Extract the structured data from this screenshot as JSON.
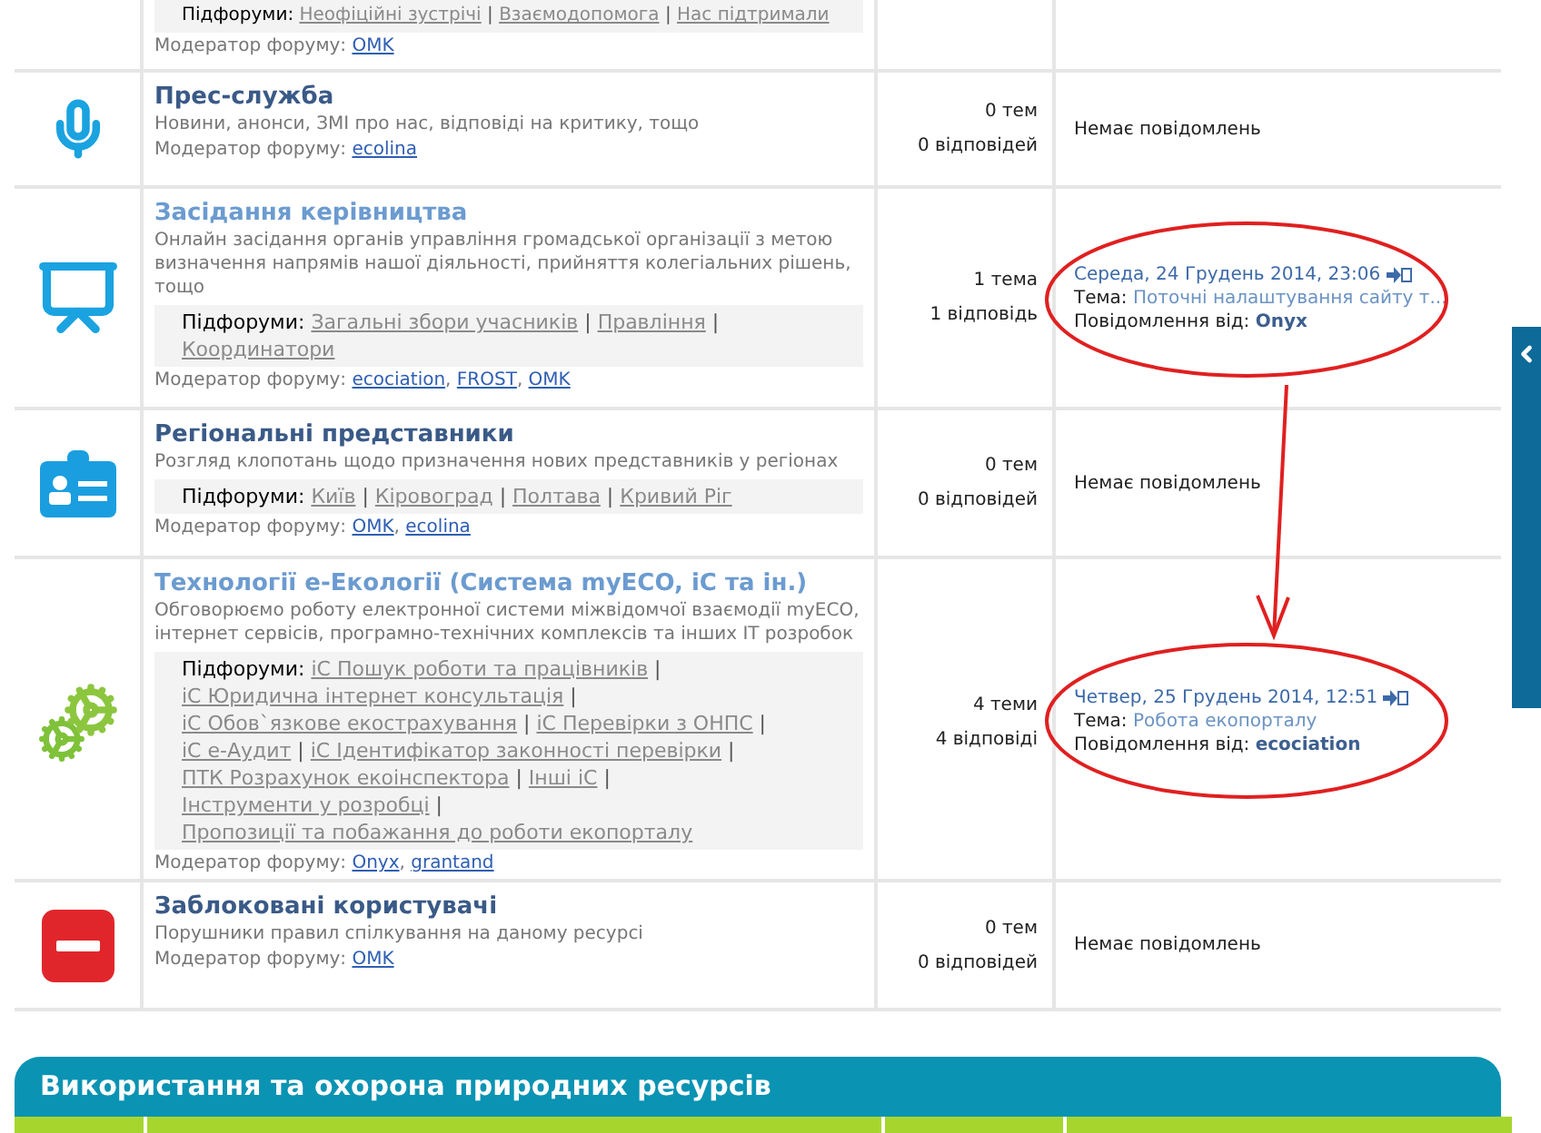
{
  "separator": "|",
  "moderator_separator": ",",
  "top_forum": {
    "subforums_label": "Підфоруми:",
    "subforums": [
      "Неофіційні зустрічі",
      "Взаємодопомога",
      "Нас підтримали"
    ],
    "moderator_label": "Модератор форуму:",
    "moderators": [
      "OMK"
    ]
  },
  "forums": [
    {
      "kind": "microphone",
      "title": "Прес-служба",
      "visited": false,
      "description": "Новини, анонси, ЗМІ про нас, відповіді на критику, тощо",
      "moderator_label": "Модератор форуму:",
      "moderators": [
        "ecolina"
      ],
      "topics": "0 тем",
      "replies": "0 відповідей",
      "last_post": {
        "kind": "empty",
        "text": "Немає повідомлень"
      }
    },
    {
      "kind": "presentation",
      "title": "Засідання керівництва",
      "visited": true,
      "description": "Онлайн засідання органів управління громадської організації з метою визначення напрямів нашої діяльності, прийняття колегіальних рішень, тощо",
      "subforums_label": "Підфоруми:",
      "subforums": [
        "Загальні збори учасників",
        "Правління",
        "Координатори"
      ],
      "moderator_label": "Модератор форуму:",
      "moderators": [
        "ecociation",
        "FROST",
        "OMK"
      ],
      "topics": "1 тема",
      "replies": "1 відповідь",
      "last_post": {
        "kind": "post",
        "date": "Середа, 24 Грудень 2014, 23:06",
        "topic_label": "Тема:",
        "topic": "Поточні налаштування сайту т...",
        "by_label": "Повідомлення від:",
        "author": "Onyx"
      }
    },
    {
      "kind": "badge",
      "title": "Регіональні представники",
      "visited": false,
      "description": "Розгляд клопотань щодо призначення нових представників у регіонах",
      "subforums_label": "Підфоруми:",
      "subforums": [
        "Київ",
        "Кіровоград",
        "Полтава",
        "Кривий Ріг"
      ],
      "moderator_label": "Модератор форуму:",
      "moderators": [
        "OMK",
        "ecolina"
      ],
      "topics": "0 тем",
      "replies": "0 відповідей",
      "last_post": {
        "kind": "empty",
        "text": "Немає повідомлень"
      }
    },
    {
      "kind": "gears",
      "title": "Технології e-Екології (Система myECO, iC та ін.)",
      "visited": true,
      "description": "Обговорюємо роботу електронної системи міжвідомчої взаємодії myECO, інтернет сервісів, програмно-технічних комплексів та інших IT розробок",
      "subforums_label": "Підфоруми:",
      "subforums": [
        "iC Пошук роботи та працівників",
        "iC Юридична інтернет консультація",
        "iC Обов`язкове екострахування",
        "iC Перевірки з ОНПС",
        "iC e-Аудит",
        "iC Ідентифікатор законності перевірки",
        "ПТК Розрахунок екоінспектора",
        "Інші iC",
        "Інструменти у розробці",
        "Пропозиції та побажання до роботи екопорталу"
      ],
      "moderator_label": "Модератор форуму:",
      "moderators": [
        "Onyx",
        "grantand"
      ],
      "topics": "4 теми",
      "replies": "4 відповіді",
      "last_post": {
        "kind": "post",
        "date": "Четвер, 25 Грудень 2014, 12:51",
        "topic_label": "Тема:",
        "topic": "Робота екопорталу",
        "by_label": "Повідомлення від:",
        "author": "ecociation"
      }
    },
    {
      "kind": "blocked",
      "title": "Заблоковані користувачі",
      "visited": false,
      "description": "Порушники правил спілкування на даному ресурсі",
      "moderator_label": "Модератор форуму:",
      "moderators": [
        "OMK"
      ],
      "topics": "0 тем",
      "replies": "0 відповідей",
      "last_post": {
        "kind": "empty",
        "text": "Немає повідомлень"
      }
    }
  ],
  "next_section": {
    "title": "Використання та охорона природних ресурсів"
  }
}
